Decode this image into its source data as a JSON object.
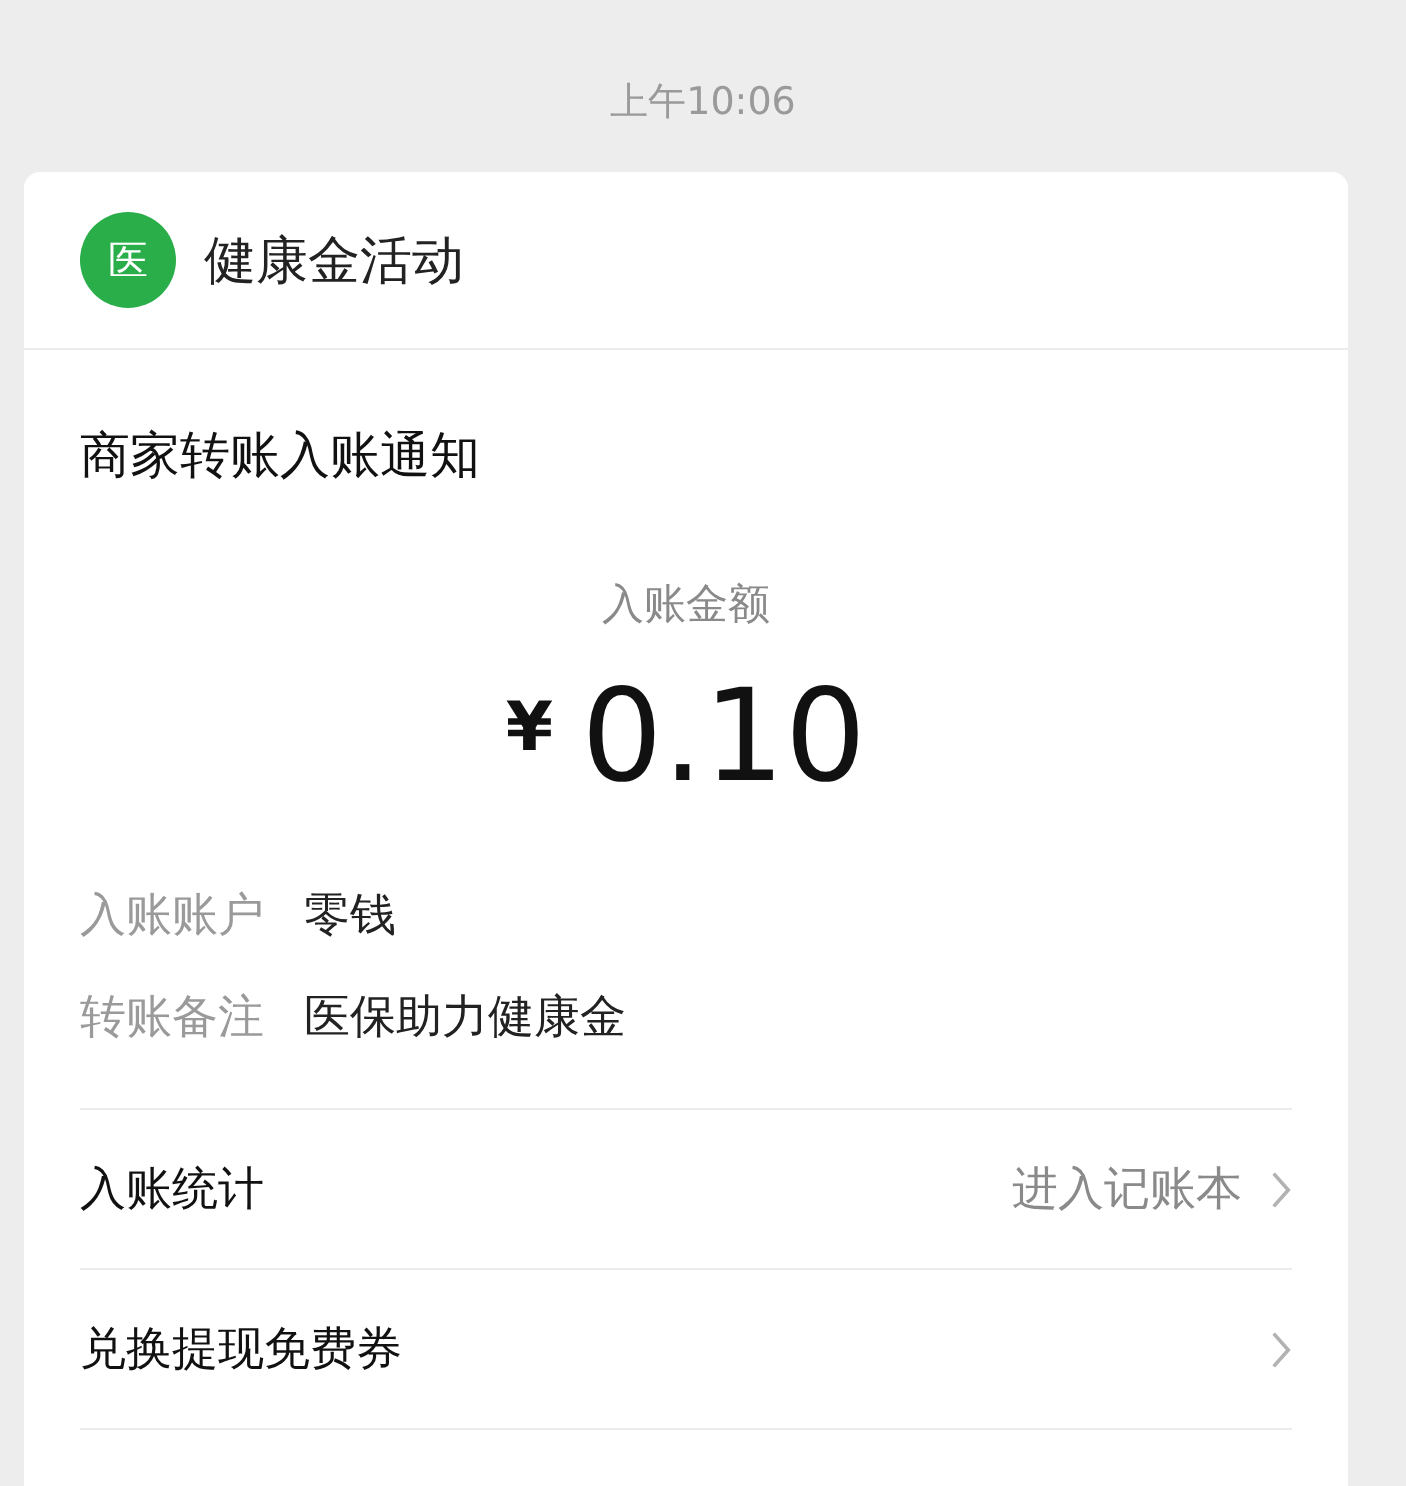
{
  "timestamp": "上午10:06",
  "account": {
    "logo_text": "医",
    "name": "健康金活动"
  },
  "notice": {
    "title": "商家转账入账通知",
    "amount_label": "入账金额",
    "currency": "¥",
    "amount": "0.10",
    "details": [
      {
        "label": "入账账户",
        "value": "零钱"
      },
      {
        "label": "转账备注",
        "value": "医保助力健康金"
      }
    ]
  },
  "links": [
    {
      "label": "入账统计",
      "hint": "进入记账本"
    },
    {
      "label": "兑换提现免费券"
    }
  ]
}
